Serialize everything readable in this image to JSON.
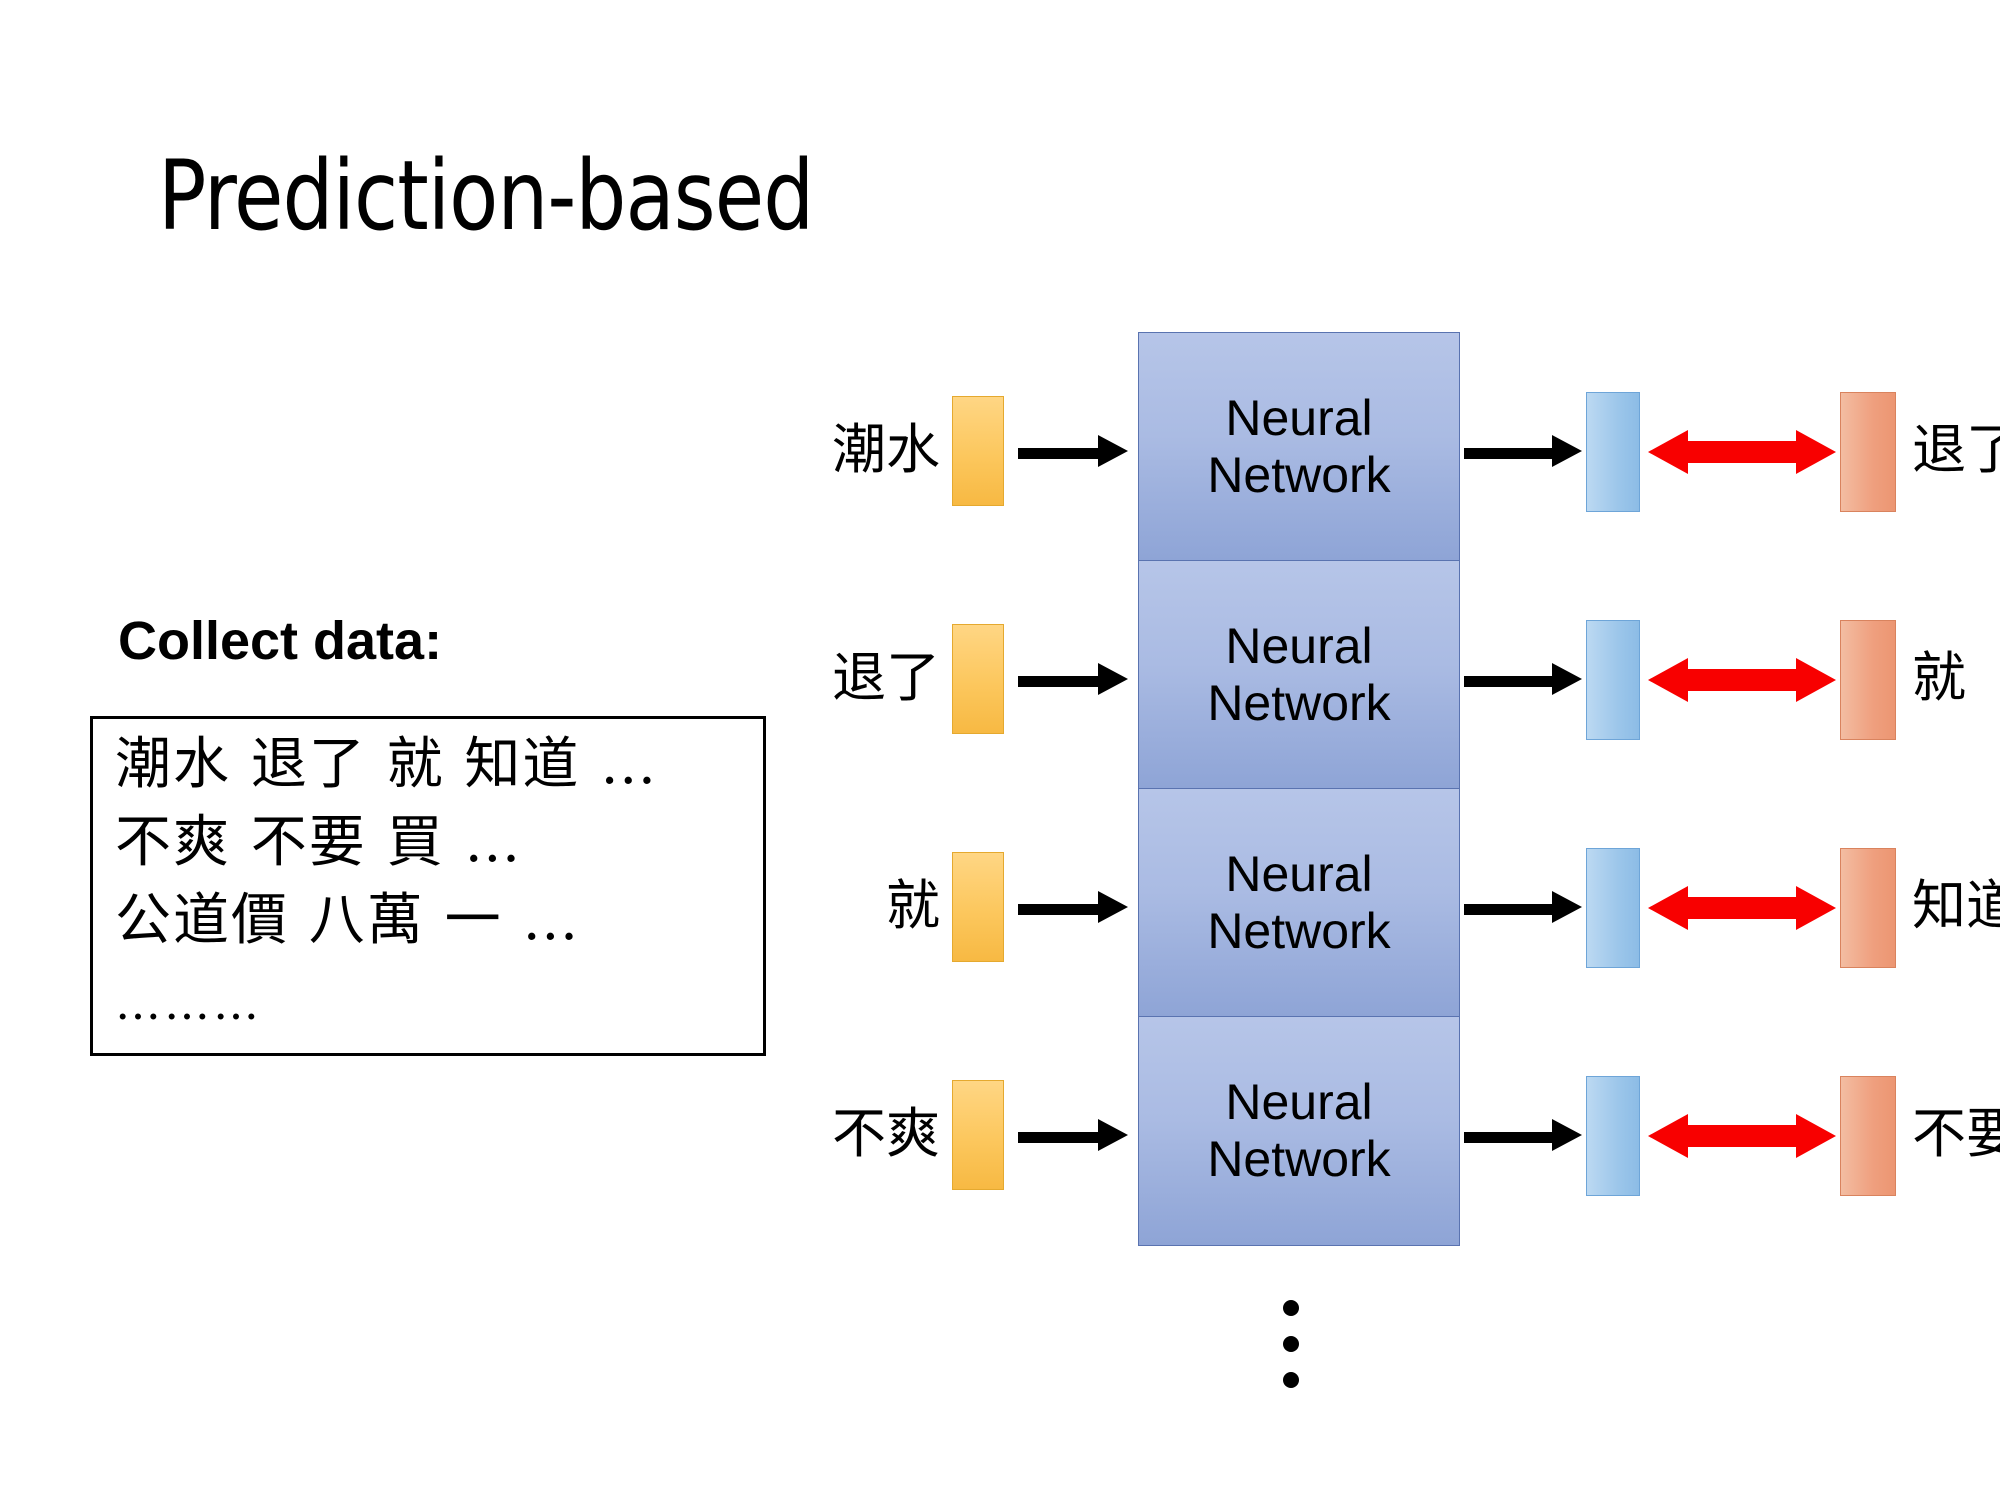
{
  "slide": {
    "title": "Prediction-based",
    "background_color": "#ffffff"
  },
  "collect_data": {
    "heading": "Collect data:",
    "lines": [
      "潮水  退了  就  知道 …",
      "不爽   不要   買 …",
      "公道價  八萬  一 …",
      "………"
    ]
  },
  "diagram": {
    "model_label_line1": "Neural",
    "model_label_line2": "Network",
    "colors": {
      "input_bar": "#fcc75d",
      "model_box": "#aabbe3",
      "output_bar": "#9cc6ea",
      "target_bar": "#ef9f7e",
      "red_arrow": "#f80000",
      "black_arrow": "#000000"
    },
    "rows": [
      {
        "input_word": "潮水",
        "output_word": "退了"
      },
      {
        "input_word": "退了",
        "output_word": "就"
      },
      {
        "input_word": "就",
        "output_word": "知道"
      },
      {
        "input_word": "不爽",
        "output_word": "不要"
      }
    ],
    "continuation_marker": "vertical-ellipsis"
  }
}
